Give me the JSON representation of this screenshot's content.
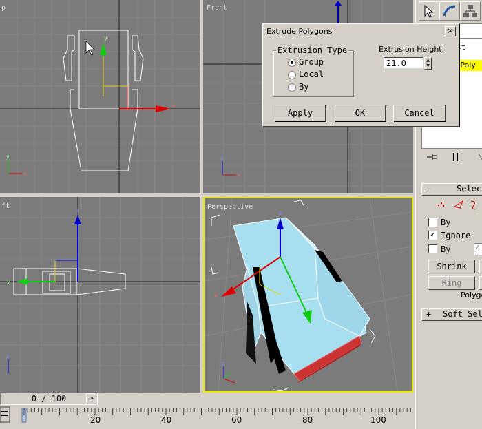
{
  "viewports": {
    "top": {
      "label": "p"
    },
    "front": {
      "label": "Front"
    },
    "left": {
      "label": "ft"
    },
    "perspective": {
      "label": "Perspective"
    }
  },
  "axis_labels": {
    "x": "x",
    "y": "y",
    "z": "z"
  },
  "dialog": {
    "title": "Extrude Polygons",
    "close": "×",
    "extrusion_type_label": "Extrusion Type",
    "options": [
      "Group",
      "Local",
      "By"
    ],
    "selected_option": "Group",
    "extrusion_height_label": "Extrusion Height:",
    "extrusion_height_value": "21.0",
    "apply_label": "Apply",
    "ok_label": "OK",
    "cancel_label": "Cancel"
  },
  "command_panel": {
    "name_field": "st",
    "modifier_item": "le Poly",
    "selection_rollout": "Select",
    "soft_selection_rollout": "Soft Sel",
    "by_vertex_label": "By",
    "ignore_label": "Ignore",
    "by_angle_label": "By",
    "angle_value": "4",
    "shrink_label": "Shrink",
    "ring_label": "Ring",
    "polygon_label": "Polygo",
    "rollout_minus": "-",
    "rollout_plus": "+"
  },
  "timeline": {
    "frame_display": "0 / 100",
    "tick_labels": [
      "20",
      "40",
      "60",
      "80",
      "100"
    ]
  }
}
